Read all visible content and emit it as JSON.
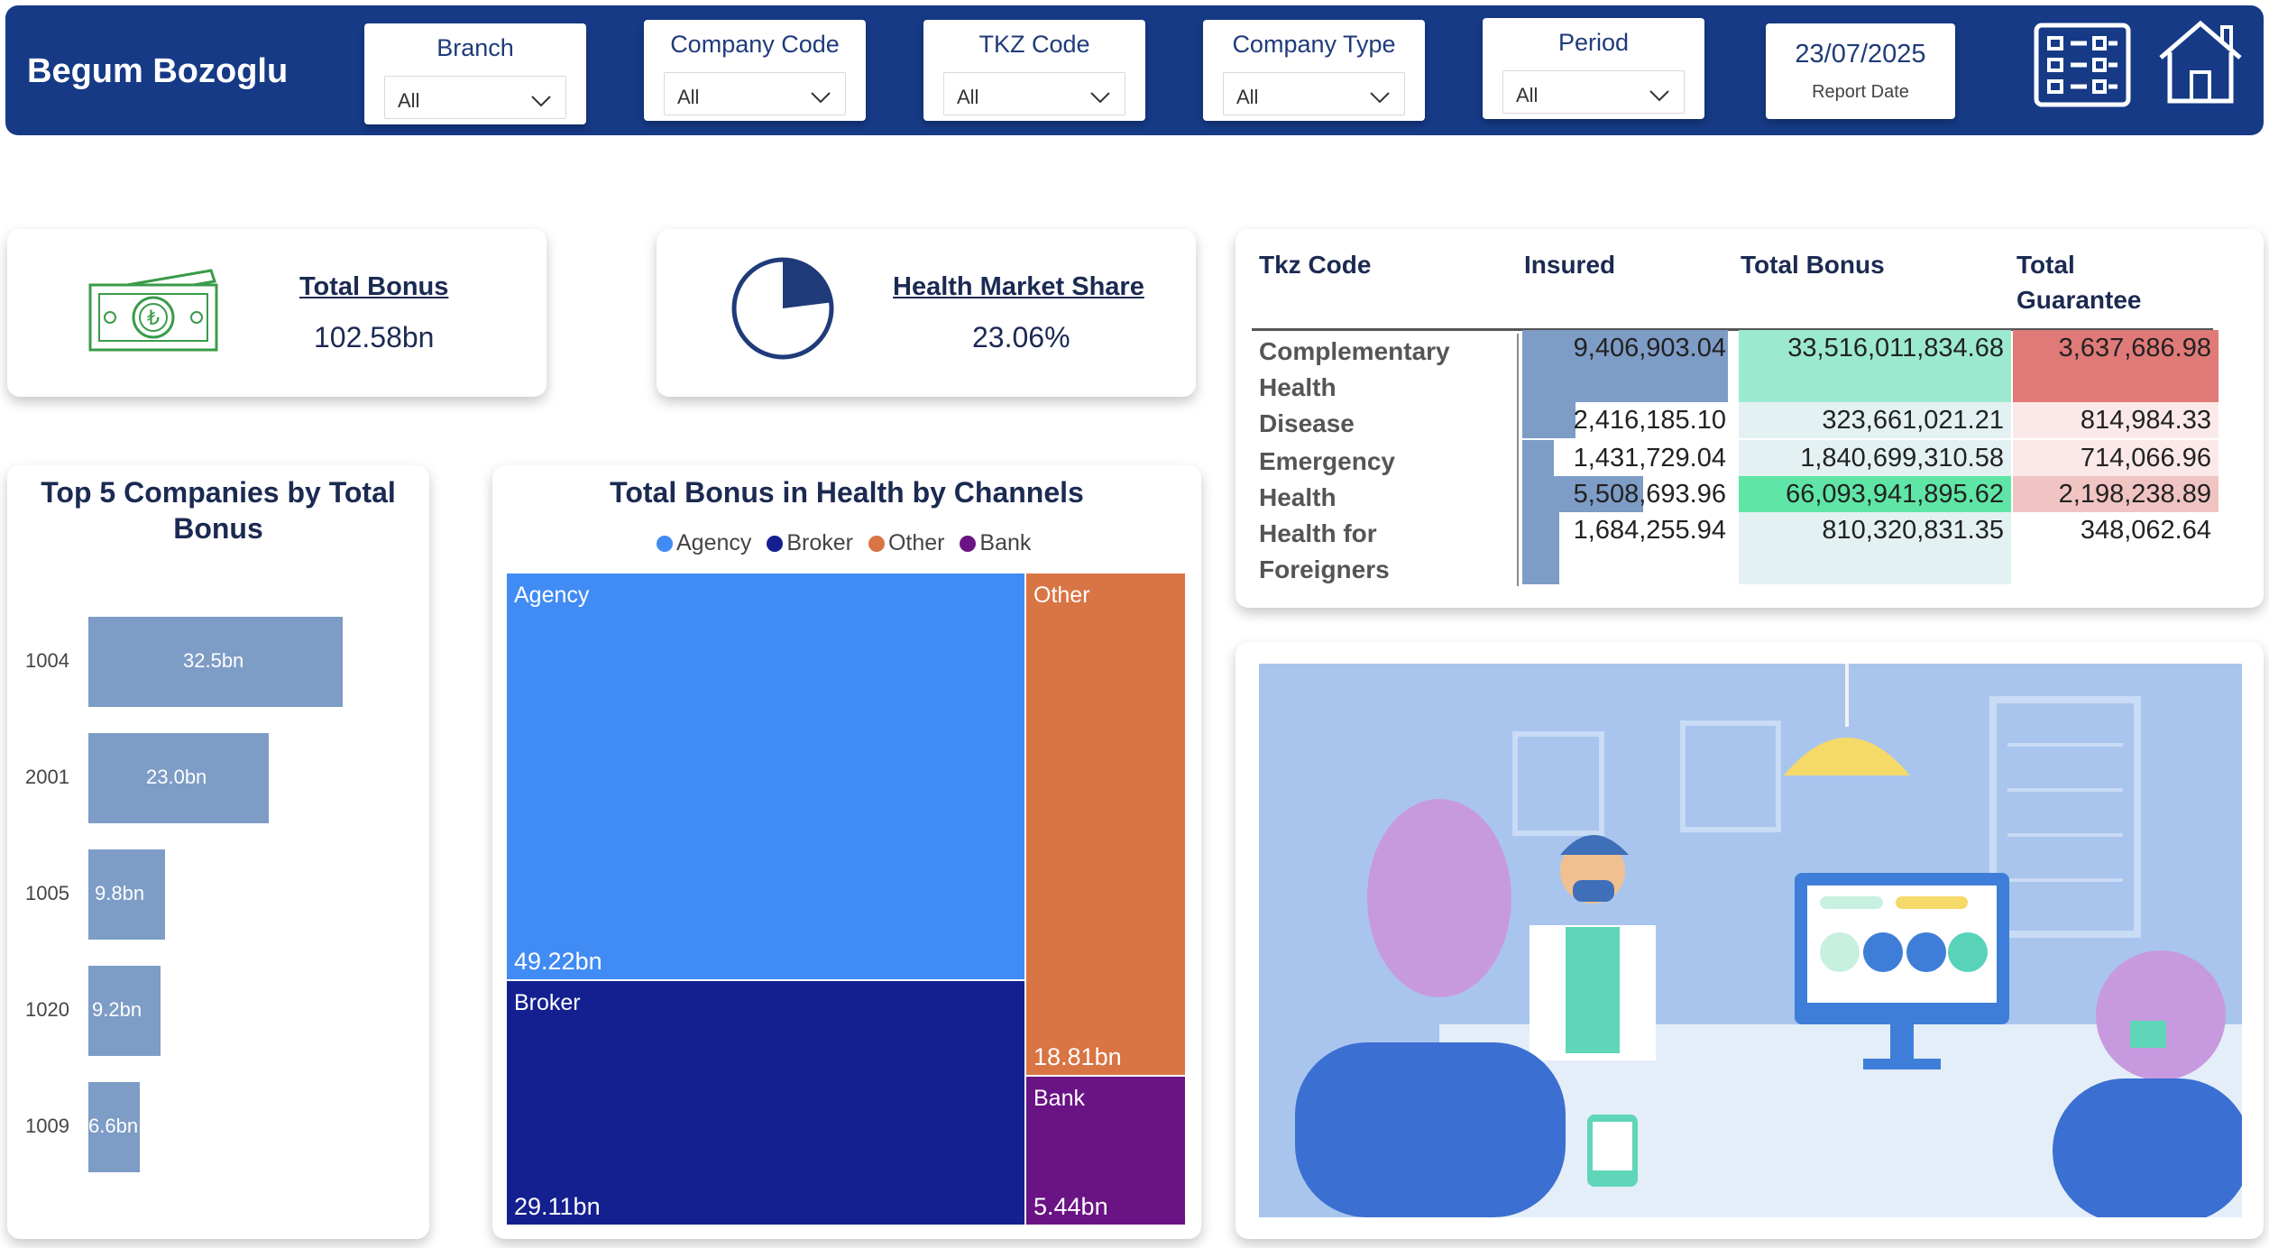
{
  "header": {
    "title": "Begum Bozoglu",
    "slicers": [
      {
        "label": "Branch",
        "value": "All"
      },
      {
        "label": "Company Code",
        "value": "All"
      },
      {
        "label": "TKZ Code",
        "value": "All"
      },
      {
        "label": "Company Type",
        "value": "All"
      },
      {
        "label": "Period",
        "value": "All"
      }
    ],
    "report_date": {
      "value": "23/07/2025",
      "label": "Report Date"
    },
    "icons": [
      "slicer-panel-icon",
      "home-icon"
    ]
  },
  "kpis": {
    "total_bonus": {
      "title": "Total Bonus",
      "value": "102.58bn",
      "icon": "banknote-lira-icon"
    },
    "health_market_share": {
      "title": "Health Market Share",
      "value": "23.06%",
      "icon": "pie-progress-icon",
      "share": 0.2306
    }
  },
  "top5": {
    "title_line1": "Top 5 Companies by Total",
    "title_line2": "Bonus",
    "chart_data": {
      "type": "bar",
      "title": "Top 5 Companies by Total Bonus",
      "categories": [
        "1004",
        "2001",
        "1005",
        "1020",
        "1009"
      ],
      "values": [
        32.5,
        23.0,
        9.8,
        9.2,
        6.6
      ],
      "labels": [
        "32.5bn",
        "23.0bn",
        "9.8bn",
        "9.2bn",
        "6.6bn"
      ],
      "orientation": "horizontal",
      "unit": "bn",
      "color": "#7d9cc6"
    }
  },
  "treemap": {
    "title": "Total Bonus in Health by Channels",
    "chart_data": {
      "type": "treemap",
      "title": "Total Bonus in Health by Channels",
      "legend": [
        "Agency",
        "Broker",
        "Other",
        "Bank"
      ],
      "series": [
        {
          "name": "Agency",
          "value": 49.22,
          "label": "49.22bn",
          "color": "#418bf4"
        },
        {
          "name": "Broker",
          "value": 29.11,
          "label": "29.11bn",
          "color": "#142090"
        },
        {
          "name": "Other",
          "value": 18.81,
          "label": "18.81bn",
          "color": "#d97444"
        },
        {
          "name": "Bank",
          "value": 5.44,
          "label": "5.44bn",
          "color": "#6a1384"
        }
      ]
    }
  },
  "table": {
    "headers": [
      "Tkz Code",
      "Insured",
      "Total Bonus",
      "Total",
      "Guarantee"
    ],
    "rows": [
      {
        "label1": "Complementary",
        "label2": "Health",
        "insured": "9,406,903.04",
        "bonus": "33,516,011,834.68",
        "guarantee": "3,637,686.98",
        "insured_val": 9406903.04
      },
      {
        "label1": "Disease",
        "label2": "",
        "insured": "2,416,185.10",
        "bonus": "323,661,021.21",
        "guarantee": "814,984.33",
        "insured_val": 2416185.1
      },
      {
        "label1": "Emergency",
        "label2": "",
        "insured": "1,431,729.04",
        "bonus": "1,840,699,310.58",
        "guarantee": "714,066.96",
        "insured_val": 1431729.04
      },
      {
        "label1": "Health",
        "label2": "",
        "insured": "5,508,693.96",
        "bonus": "66,093,941,895.62",
        "guarantee": "2,198,238.89",
        "insured_val": 5508693.96
      },
      {
        "label1": "Health for",
        "label2": "Foreigners",
        "insured": "1,684,255.94",
        "bonus": "810,320,831.35",
        "guarantee": "348,062.64",
        "insured_val": 1684255.94
      }
    ],
    "colors": {
      "insured_bar": "#7d9cc6",
      "bonus_high": "#5fe6a6",
      "bonus_mid": "#9be9cf",
      "bonus_low": "#e3f1f3",
      "guarantee_high": "#e07a78",
      "guarantee_mid": "#f0c4c3",
      "guarantee_low": "#fbe9e9"
    }
  },
  "illustration": {
    "icon": "doctor-consultation-illustration"
  }
}
